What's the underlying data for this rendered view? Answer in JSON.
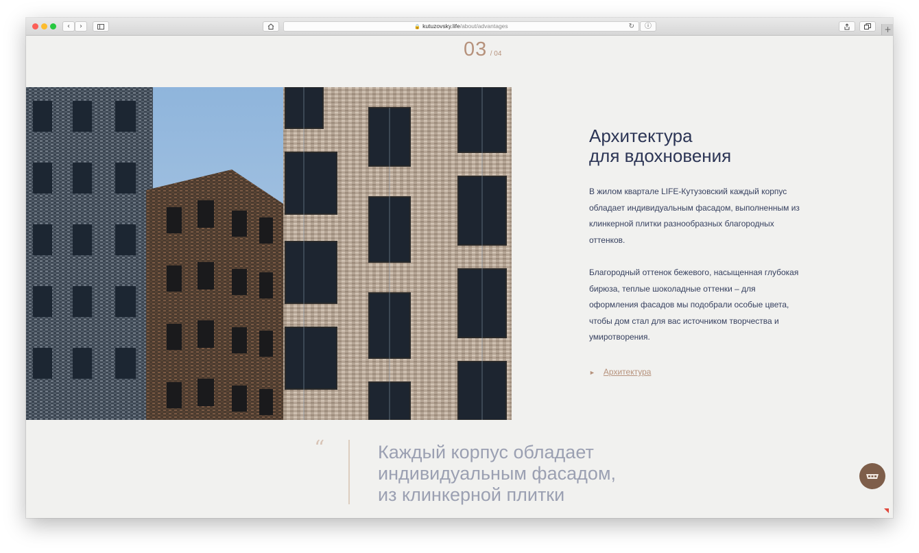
{
  "browser": {
    "url_domain": "kutuzovsky.life",
    "url_path": "/about/advantages",
    "plus_label": "+"
  },
  "slider": {
    "current": "03",
    "total": "/ 04"
  },
  "section": {
    "title_line1": "Архитектура",
    "title_line2": "для вдохновения",
    "paragraph1": "В жилом квартале LIFE-Кутузовский каждый корпус обладает индивидуальным фасадом, выполненным из клинкерной плитки разнообразных благородных оттенков.",
    "paragraph2": "Благородный оттенок бежевого, насыщенная глубокая бирюза, теплые шоколадные оттенки – для оформления фасадов мы подобрали особые цвета, чтобы дом стал для вас источником творчества и умиротворения.",
    "link_label": "Архитектура"
  },
  "quote": {
    "mark": "“",
    "line1": "Каждый корпус обладает",
    "line2": "индивидуальным фасадом,",
    "line3": "из клинкерной плитки"
  },
  "colors": {
    "accent": "#b6927c",
    "heading": "#2c3555",
    "body_text": "#36405f",
    "quote_text": "#9ba0b2",
    "chat_button": "#7e5e4a",
    "page_bg": "#f1f1ef"
  },
  "icons": {
    "back": "chevron-left-icon",
    "forward": "chevron-right-icon",
    "sidebar": "sidebar-icon",
    "home": "home-icon",
    "lock": "lock-icon",
    "reload": "reload-icon",
    "info": "info-icon",
    "share": "share-icon",
    "tabs": "tabs-icon",
    "chat": "chat-icon"
  }
}
